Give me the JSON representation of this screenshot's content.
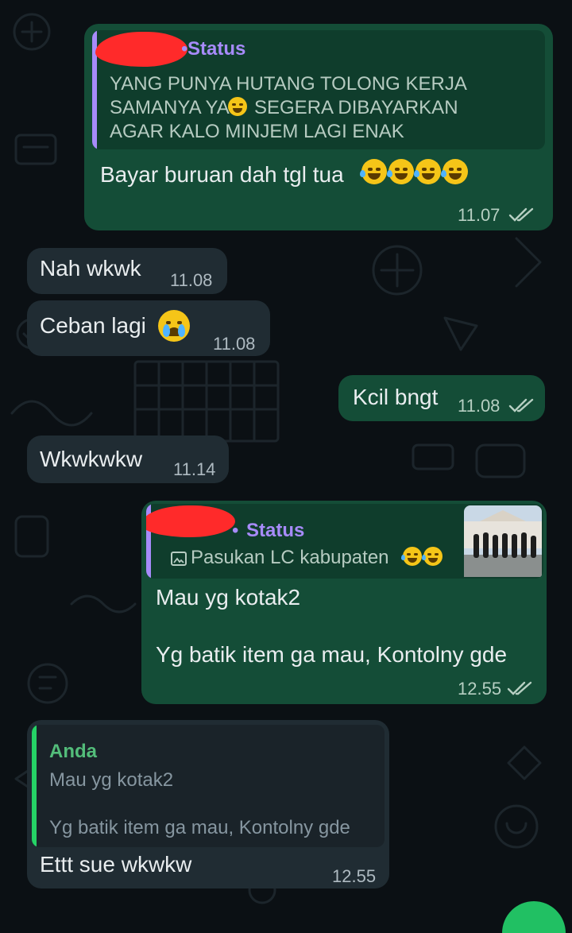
{
  "colors": {
    "outgoing_bubble": "#144d37",
    "incoming_bubble": "#202c33",
    "quote_bar_status": "#a78bfa",
    "quote_bar_reply": "#25d366",
    "quote_author_reply": "#53bd7a",
    "read_ticks": "#b6cfc2"
  },
  "messages": [
    {
      "direction": "outgoing",
      "quote": {
        "author": "Status",
        "author_redacted": true,
        "lines": [
          "YANG PUNYA HUTANG TOLONG KERJA",
          "SAMANYA YA",
          "SEGERA DIBAYARKAN",
          "AGAR KALO MINJEM LAGI ENAK"
        ],
        "emoji": "grinning-face"
      },
      "text": "Bayar buruan dah tgl tua",
      "emojis": [
        "rolling-on-floor-laughing",
        "rolling-on-floor-laughing",
        "rolling-on-floor-laughing",
        "rolling-on-floor-laughing"
      ],
      "time": "11.07",
      "status": "read"
    },
    {
      "direction": "incoming",
      "text": "Nah wkwk",
      "time": "11.08"
    },
    {
      "direction": "incoming",
      "text": "Ceban lagi",
      "emojis": [
        "loudly-crying-face"
      ],
      "time": "11.08"
    },
    {
      "direction": "outgoing",
      "text": "Kcil bngt",
      "time": "11.08",
      "status": "read"
    },
    {
      "direction": "incoming",
      "text": "Wkwkwkw",
      "time": "11.14"
    },
    {
      "direction": "outgoing",
      "quote": {
        "author": "Status",
        "author_redacted": true,
        "caption": "Pasukan LC kabupaten",
        "emojis": [
          "rolling-on-floor-laughing",
          "rolling-on-floor-laughing"
        ],
        "has_thumbnail": true,
        "icon": "photo-icon"
      },
      "text_lines": [
        "Mau yg kotak2",
        "Yg batik item ga mau, Kontolny gde"
      ],
      "time": "12.55",
      "status": "read"
    },
    {
      "direction": "incoming",
      "quote": {
        "author": "Anda",
        "lines": [
          "Mau yg kotak2",
          "Yg batik item ga mau, Kontolny gde"
        ]
      },
      "text": "Ettt sue wkwkw",
      "time": "12.55"
    }
  ]
}
